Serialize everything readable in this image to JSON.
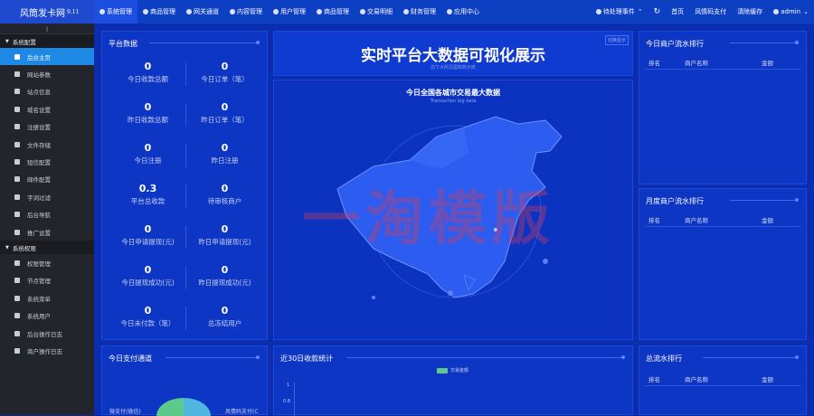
{
  "app": {
    "title": "风筒发卡网",
    "version": "9.11"
  },
  "nav": [
    {
      "label": "系统管理"
    },
    {
      "label": "商品管理"
    },
    {
      "label": "网关通道"
    },
    {
      "label": "内容管理"
    },
    {
      "label": "用户管理"
    },
    {
      "label": "商品管理"
    },
    {
      "label": "交易明细"
    },
    {
      "label": "财务管理"
    },
    {
      "label": "应用中心"
    }
  ],
  "right_nav": {
    "pending": "待处理事件",
    "home": "首页",
    "link": "风情码支付",
    "clear": "清除缓存",
    "user": "admin"
  },
  "sidebar": {
    "group1": "系统配置",
    "items1": [
      "后台主页",
      "网站参数",
      "站点信息",
      "域名设置",
      "注册设置",
      "文件存储",
      "短信配置",
      "邮件配置",
      "字词过滤",
      "后台导航",
      "推广设置"
    ],
    "group2": "系统权限",
    "items2": [
      "权限管理",
      "节点管理",
      "系统菜单",
      "系统用户",
      "后台操作日志",
      "商户操作日志"
    ]
  },
  "platform": {
    "title": "平台数据",
    "stats": [
      {
        "value": "0",
        "label": "今日收款总额"
      },
      {
        "value": "0",
        "label": "今日订单（笔）"
      },
      {
        "value": "0",
        "label": "昨日收款总额"
      },
      {
        "value": "0",
        "label": "昨日订单（笔）"
      },
      {
        "value": "0",
        "label": "今日注册"
      },
      {
        "value": "0",
        "label": "昨日注册"
      },
      {
        "value": "0.3",
        "label": "平台总收款"
      },
      {
        "value": "0",
        "label": "待审核商户"
      },
      {
        "value": "0",
        "label": "今日申请提现(元)"
      },
      {
        "value": "0",
        "label": "昨日申请提现(元)"
      },
      {
        "value": "0",
        "label": "今日提现成功(元)"
      },
      {
        "value": "0",
        "label": "昨日提现成功(元)"
      },
      {
        "value": "0",
        "label": "今日未付款（笔）"
      },
      {
        "value": "0",
        "label": "总冻结用户"
      }
    ]
  },
  "center": {
    "title": "实时平台大数据可视化展示",
    "subtitle": "前下大所见图数数示统",
    "tag": "切换显示",
    "map_title": "今日全国各城市交易最大数据",
    "map_subtitle": "Transaction big data"
  },
  "today_rank": {
    "title": "今日商户流水排行",
    "col_rank": "排名",
    "col_name": "商户名称",
    "col_amount": "金额"
  },
  "month_rank": {
    "title": "月度商户流水排行",
    "col_rank": "排名",
    "col_name": "商户名称",
    "col_amount": "金额"
  },
  "total_rank": {
    "title": "总流水排行",
    "col_rank": "排名",
    "col_name": "商户名称",
    "col_amount": "金额"
  },
  "channel": {
    "title": "今日支付通道",
    "left_label": "微支付(微信)",
    "right_label": "风情码支付(C"
  },
  "income": {
    "title": "近30日收款统计",
    "legend": "交易金额",
    "y_ticks": [
      "1",
      "0.8"
    ]
  },
  "watermark": "一淘模版",
  "colors": {
    "accent": "#1e88e5",
    "bg": "#0b2eb0",
    "legend": "#5dc98a"
  }
}
